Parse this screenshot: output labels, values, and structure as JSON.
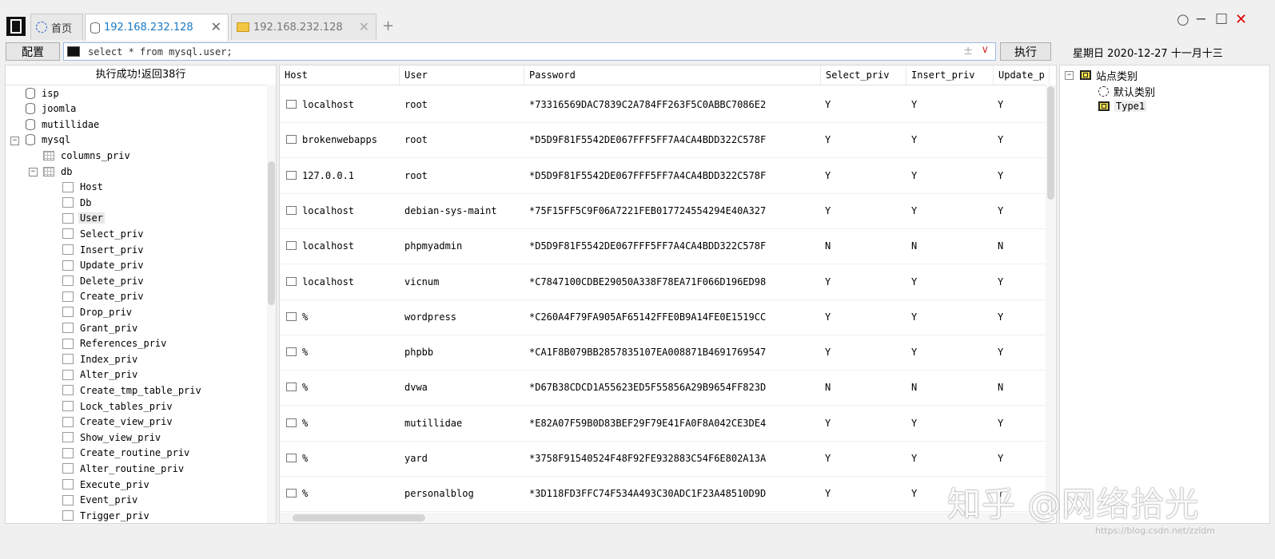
{
  "tabs": [
    {
      "label": "首页",
      "icon": "globe-icon"
    },
    {
      "label": "192.168.232.128",
      "icon": "database-icon",
      "active": true
    },
    {
      "label": "192.168.232.128",
      "icon": "folder-icon"
    }
  ],
  "toolbar": {
    "config_label": "配置",
    "sql": "select * from mysql.user;",
    "pm_symbol": "±",
    "exec_label": "执行",
    "date": "星期日 2020-12-27 十一月十三"
  },
  "window_controls": {
    "minimize": "─",
    "restore": "☐",
    "close": "✕",
    "circle": "○"
  },
  "tree": {
    "status": "执行成功!返回38行",
    "databases": [
      "isp",
      "joomla",
      "mutillidae",
      "mysql"
    ],
    "tables": [
      "columns_priv",
      "db"
    ],
    "columns": [
      "Host",
      "Db",
      "User",
      "Select_priv",
      "Insert_priv",
      "Update_priv",
      "Delete_priv",
      "Create_priv",
      "Drop_priv",
      "Grant_priv",
      "References_priv",
      "Index_priv",
      "Alter_priv",
      "Create_tmp_table_priv",
      "Lock_tables_priv",
      "Create_view_priv",
      "Show_view_priv",
      "Create_routine_priv",
      "Alter_routine_priv",
      "Execute_priv",
      "Event_priv",
      "Trigger_priv"
    ],
    "selected_column": "User"
  },
  "grid": {
    "headers": [
      "Host",
      "User",
      "Password",
      "Select_priv",
      "Insert_priv",
      "Update_p"
    ],
    "rows": [
      [
        "localhost",
        "root",
        "*73316569DAC7839C2A784FF263F5C0ABBC7086E2",
        "Y",
        "Y",
        "Y"
      ],
      [
        "brokenwebapps",
        "root",
        "*D5D9F81F5542DE067FFF5FF7A4CA4BDD322C578F",
        "Y",
        "Y",
        "Y"
      ],
      [
        "127.0.0.1",
        "root",
        "*D5D9F81F5542DE067FFF5FF7A4CA4BDD322C578F",
        "Y",
        "Y",
        "Y"
      ],
      [
        "localhost",
        "debian-sys-maint",
        "*75F15FF5C9F06A7221FEB017724554294E40A327",
        "Y",
        "Y",
        "Y"
      ],
      [
        "localhost",
        "phpmyadmin",
        "*D5D9F81F5542DE067FFF5FF7A4CA4BDD322C578F",
        "N",
        "N",
        "N"
      ],
      [
        "localhost",
        "vicnum",
        "*C7847100CDBE29050A338F78EA71F066D196ED98",
        "Y",
        "Y",
        "Y"
      ],
      [
        "%",
        "wordpress",
        "*C260A4F79FA905AF65142FFE0B9A14FE0E1519CC",
        "Y",
        "Y",
        "Y"
      ],
      [
        "%",
        "phpbb",
        "*CA1F8B079BB2857835107EA008871B4691769547",
        "Y",
        "Y",
        "Y"
      ],
      [
        "%",
        "dvwa",
        "*D67B38CDCD1A55623ED5F55856A29B9654FF823D",
        "N",
        "N",
        "N"
      ],
      [
        "%",
        "mutillidae",
        "*E82A07F59B0D83BEF29F79E41FA0F8A042CE3DE4",
        "Y",
        "Y",
        "Y"
      ],
      [
        "%",
        "yard",
        "*3758F91540524F48F92FE932883C54F6E802A13A",
        "Y",
        "Y",
        "Y"
      ],
      [
        "%",
        "personalblog",
        "*3D118FD3FFC74F534A493C30ADC1F23A48510D9D",
        "Y",
        "Y",
        "Y"
      ]
    ]
  },
  "right_tree": {
    "root": "站点类别",
    "children": [
      "默认类别",
      "Type1"
    ]
  },
  "watermark": {
    "zhihu": "知乎 @网络拾光",
    "csdn": "https://blog.csdn.net/zzldm"
  }
}
